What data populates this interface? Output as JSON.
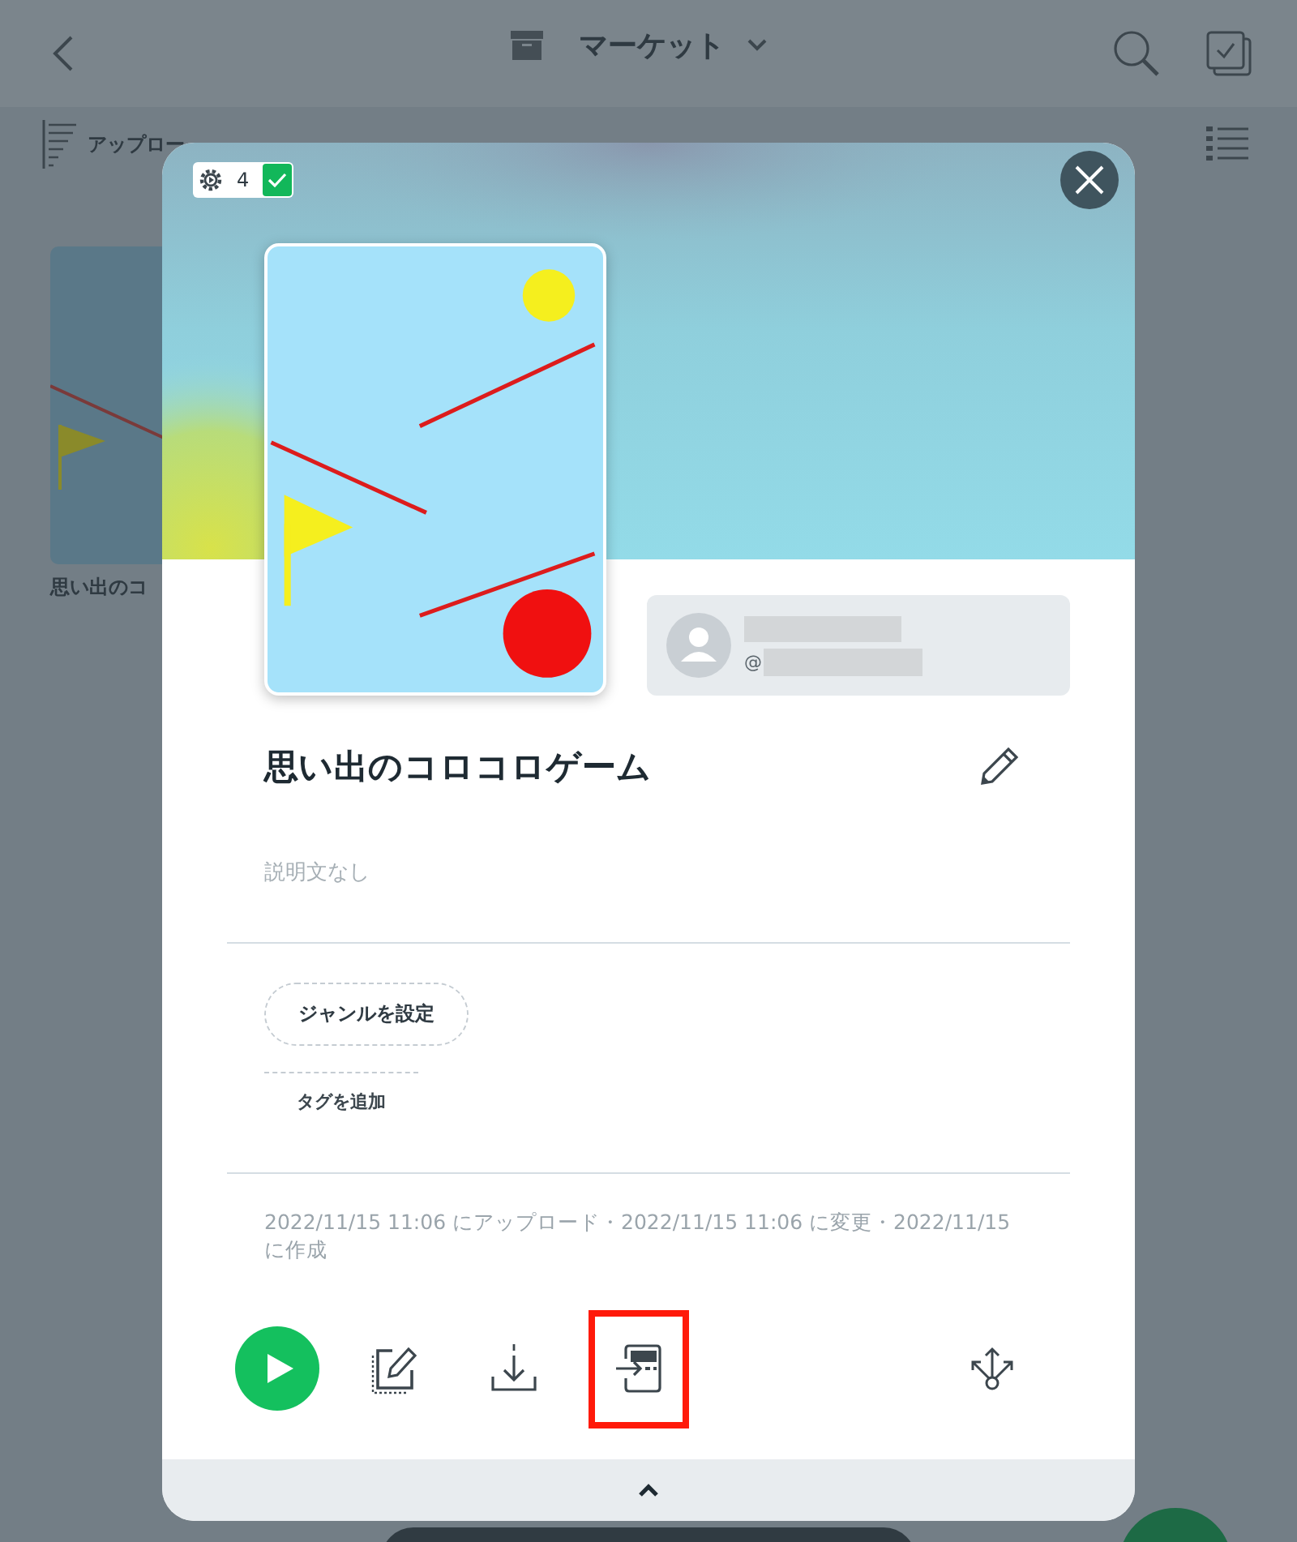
{
  "header": {
    "title": "マーケット"
  },
  "toolbar": {
    "sort_label": "アップロー"
  },
  "grid": [
    {
      "title": "思い出のコ",
      "kind": "picture"
    }
  ],
  "dialog": {
    "badge": {
      "count": "4",
      "checked": true
    },
    "user": {
      "at_sign": "@"
    },
    "title": "思い出のコロコロゲーム",
    "description": {
      "placeholder": "説明文なし"
    },
    "genre_button": "ジャンルを設定",
    "tag_button": "タグを追加",
    "dates": "2022/11/15 11:06 にアップロード・2022/11/15 11:06 に変更・2022/11/15 に作成",
    "actions": [
      {
        "kind": "play",
        "highlighted": false
      },
      {
        "kind": "edit",
        "highlighted": false
      },
      {
        "kind": "download",
        "highlighted": false
      },
      {
        "kind": "import",
        "highlighted": true
      },
      {
        "kind": "share",
        "highlighted": false
      }
    ]
  }
}
